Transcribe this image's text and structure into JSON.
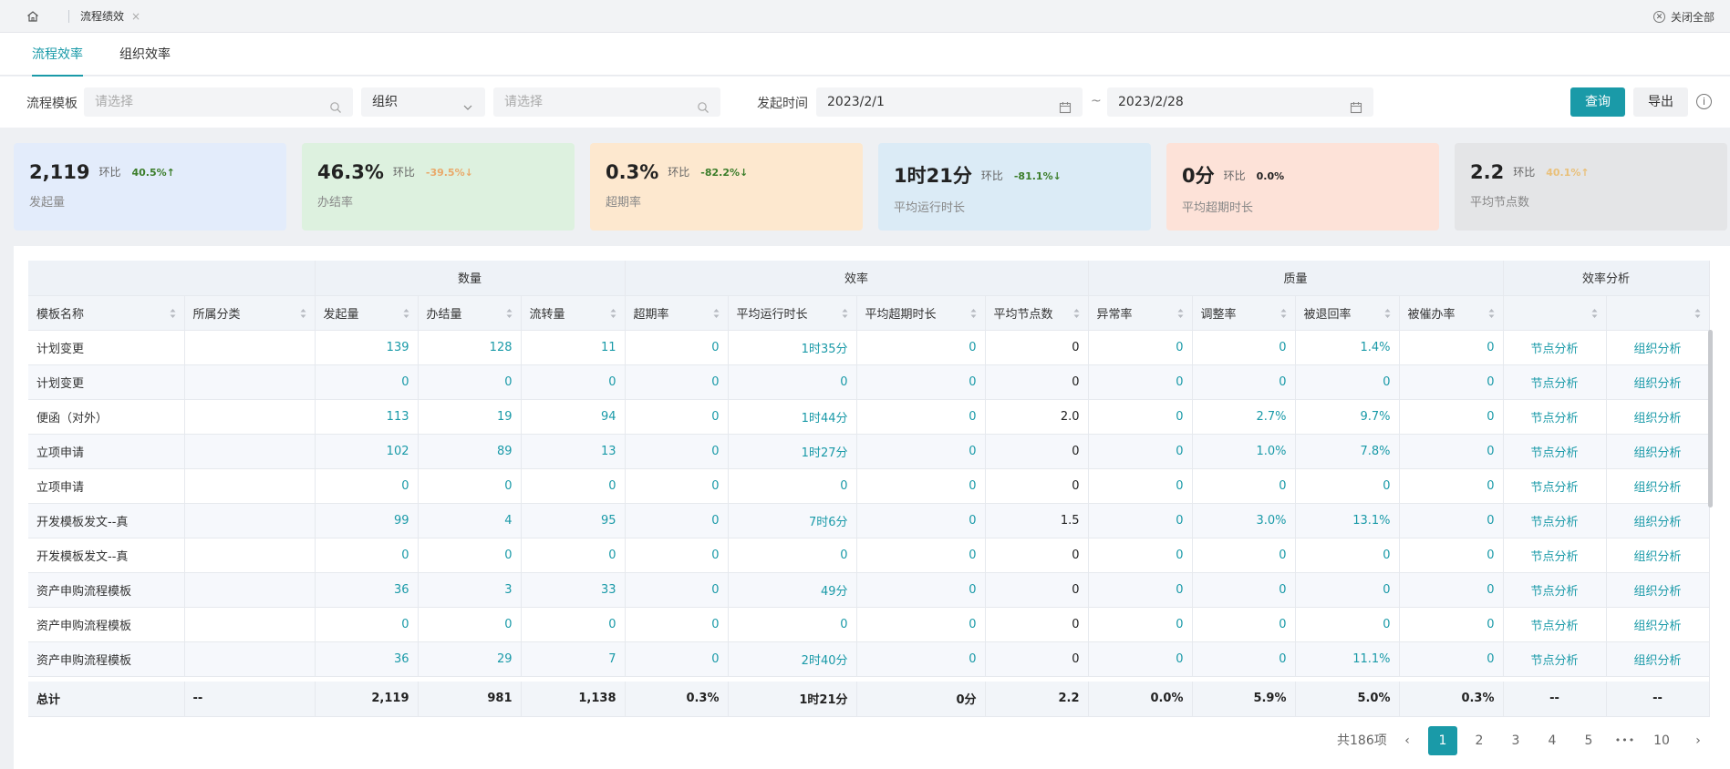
{
  "topbar": {
    "tab_label": "流程绩效",
    "close_x": "×",
    "close_all": "关闭全部"
  },
  "subtabs": [
    "流程效率",
    "组织效率"
  ],
  "filter": {
    "template_label": "流程模板",
    "template_placeholder": "请选择",
    "org_select": "组织",
    "org_placeholder": "请选择",
    "time_label": "发起时间",
    "start_date": "2023/2/1",
    "tilde": "~",
    "end_date": "2023/2/28",
    "query_btn": "查询",
    "export_btn": "导出"
  },
  "cards": [
    {
      "value": "2,119",
      "hb": "环比",
      "pct": "40.5%↑",
      "label": "发起量",
      "bg": "#e3ecfb",
      "pct_color": "#3b7d2a"
    },
    {
      "value": "46.3%",
      "hb": "环比",
      "pct": "-39.5%↓",
      "label": "办结率",
      "bg": "#ddf1df",
      "pct_color": "#e9a96a"
    },
    {
      "value": "0.3%",
      "hb": "环比",
      "pct": "-82.2%↓",
      "label": "超期率",
      "bg": "#fde8cf",
      "pct_color": "#3b7d2a"
    },
    {
      "value": "1时21分",
      "hb": "环比",
      "pct": "-81.1%↓",
      "label": "平均运行时长",
      "bg": "#dbebf6",
      "pct_color": "#3b7d2a"
    },
    {
      "value": "0分",
      "hb": "环比",
      "pct": "0.0%",
      "label": "平均超期时长",
      "bg": "#fde2d8",
      "pct_color": "#222222"
    },
    {
      "value": "2.2",
      "hb": "环比",
      "pct": "40.1%↑",
      "label": "平均节点数",
      "bg": "#e4e5e7",
      "pct_color": "#e9c07a"
    }
  ],
  "table": {
    "groups": [
      "数量",
      "效率",
      "质量",
      "效率分析"
    ],
    "columns": [
      "模板名称",
      "所属分类",
      "发起量",
      "办结量",
      "流转量",
      "超期率",
      "平均运行时长",
      "平均超期时长",
      "平均节点数",
      "异常率",
      "调整率",
      "被退回率",
      "被催办率",
      "",
      ""
    ],
    "rows": [
      [
        "计划变更",
        "",
        "139",
        "128",
        "11",
        "0",
        "1时35分",
        "0",
        "0",
        "0",
        "0",
        "1.4%",
        "0",
        "节点分析",
        "组织分析"
      ],
      [
        "计划变更",
        "",
        "0",
        "0",
        "0",
        "0",
        "0",
        "0",
        "0",
        "0",
        "0",
        "0",
        "0",
        "节点分析",
        "组织分析"
      ],
      [
        "便函（对外）",
        "",
        "113",
        "19",
        "94",
        "0",
        "1时44分",
        "0",
        "2.0",
        "0",
        "2.7%",
        "9.7%",
        "0",
        "节点分析",
        "组织分析"
      ],
      [
        "立项申请",
        "",
        "102",
        "89",
        "13",
        "0",
        "1时27分",
        "0",
        "0",
        "0",
        "1.0%",
        "7.8%",
        "0",
        "节点分析",
        "组织分析"
      ],
      [
        "立项申请",
        "",
        "0",
        "0",
        "0",
        "0",
        "0",
        "0",
        "0",
        "0",
        "0",
        "0",
        "0",
        "节点分析",
        "组织分析"
      ],
      [
        "开发模板发文--真",
        "",
        "99",
        "4",
        "95",
        "0",
        "7时6分",
        "0",
        "1.5",
        "0",
        "3.0%",
        "13.1%",
        "0",
        "节点分析",
        "组织分析"
      ],
      [
        "开发模板发文--真",
        "",
        "0",
        "0",
        "0",
        "0",
        "0",
        "0",
        "0",
        "0",
        "0",
        "0",
        "0",
        "节点分析",
        "组织分析"
      ],
      [
        "资产申购流程模板",
        "",
        "36",
        "3",
        "33",
        "0",
        "49分",
        "0",
        "0",
        "0",
        "0",
        "0",
        "0",
        "节点分析",
        "组织分析"
      ],
      [
        "资产申购流程模板",
        "",
        "0",
        "0",
        "0",
        "0",
        "0",
        "0",
        "0",
        "0",
        "0",
        "0",
        "0",
        "节点分析",
        "组织分析"
      ],
      [
        "资产申购流程模板",
        "",
        "36",
        "29",
        "7",
        "0",
        "2时40分",
        "0",
        "0",
        "0",
        "0",
        "11.1%",
        "0",
        "节点分析",
        "组织分析"
      ]
    ],
    "total": [
      "总计",
      "--",
      "2,119",
      "981",
      "1,138",
      "0.3%",
      "1时21分",
      "0分",
      "2.2",
      "0.0%",
      "5.9%",
      "5.0%",
      "0.3%",
      "--",
      "--"
    ]
  },
  "pagination": {
    "total": "共186项",
    "prev": "‹",
    "pages": [
      "1",
      "2",
      "3",
      "4",
      "5"
    ],
    "ellipsis": "•••",
    "last": "10",
    "next": "›",
    "current": "1"
  }
}
